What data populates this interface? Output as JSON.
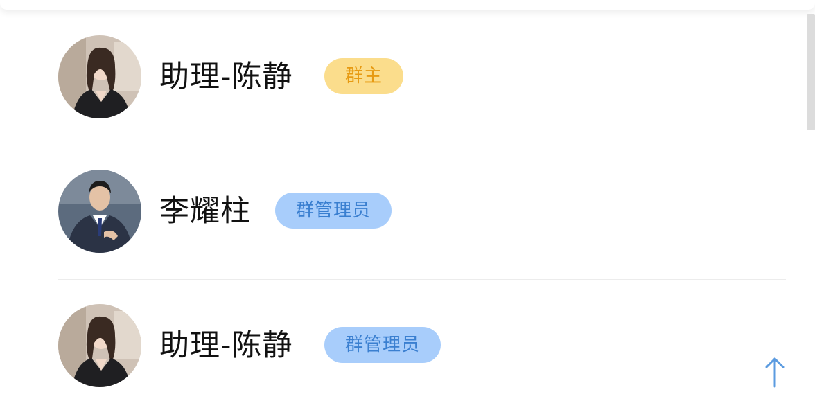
{
  "members": [
    {
      "name": "助理-陈静",
      "role": "群主",
      "avatar": "female-portrait"
    },
    {
      "name": "李耀柱",
      "role": "群管理员",
      "avatar": "male-portrait"
    },
    {
      "name": "助理-陈静",
      "role": "群管理员",
      "avatar": "female-portrait"
    }
  ],
  "colors": {
    "owner_badge_bg": "#fbdd8c",
    "owner_badge_text": "#e79a12",
    "admin_badge_bg": "#a8cdfb",
    "admin_badge_text": "#3a7fd0",
    "back_top_arrow": "#5b9be0"
  },
  "icons": {
    "back_to_top": "arrow-up-icon"
  }
}
